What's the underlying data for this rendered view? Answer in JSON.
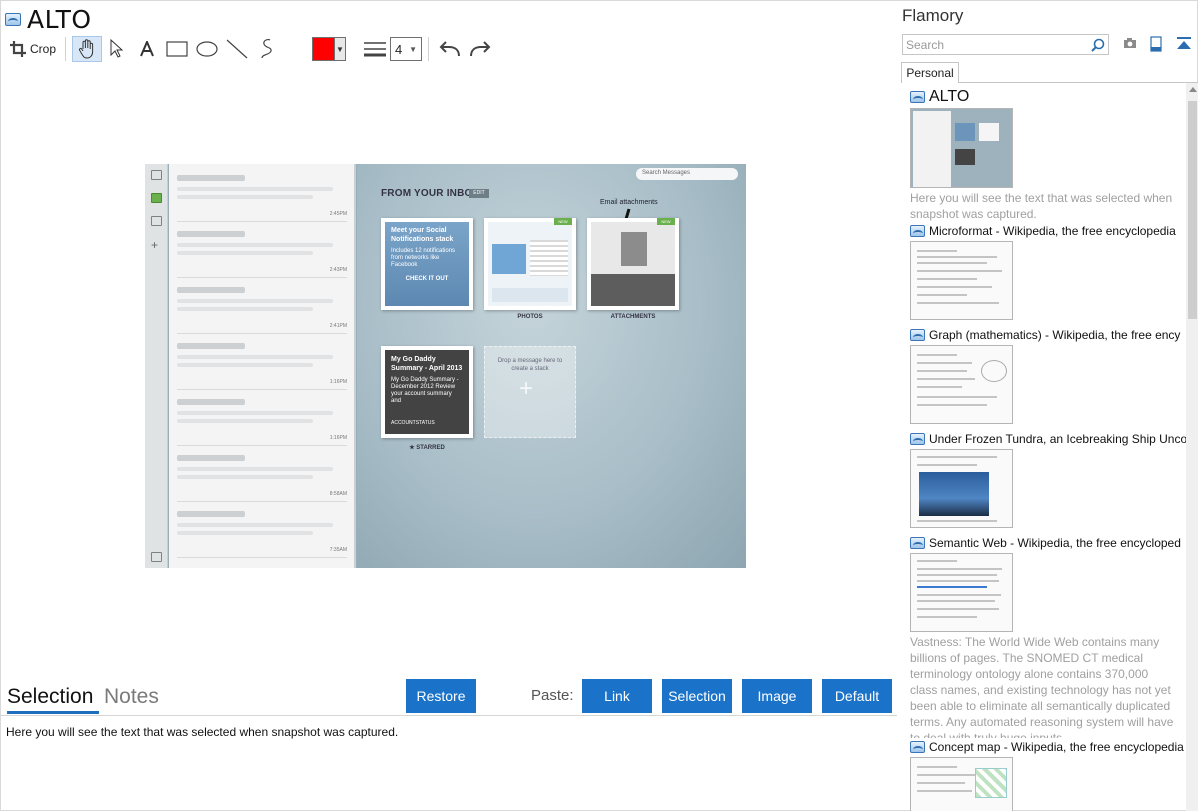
{
  "app": {
    "title": "ALTO",
    "brand": "Flamory"
  },
  "toolbar": {
    "crop_label": "Crop",
    "line_width": "4",
    "stroke_color": "#ff0000"
  },
  "screenshot": {
    "search_placeholder": "Search Messages",
    "inbox_heading": "FROM YOUR INBOX",
    "edit_tag": "EDIT",
    "email_attachments": "Email attachments",
    "new_tag": "NEW",
    "card_social": "Meet your Social Notifications stack",
    "card_social_sub": "Includes 12 notifications from networks like Facebook",
    "card_social_cta": "CHECK IT OUT",
    "caption_photos": "PHOTOS",
    "caption_attachments": "ATTACHMENTS",
    "card_godaddy": "My Go Daddy Summary - April 2013",
    "card_godaddy_sub": "My Go Daddy Summary - December 2012 Review your account summary and",
    "card_godaddy_foot": "ACCOUNTSTATUS",
    "caption_starred": "★ STARRED",
    "drop_text": "Drop a message here to create a stack",
    "mail_times": [
      "2:45PM",
      "2:43PM",
      "2:41PM",
      "1:16PM",
      "1:16PM",
      "8:58AM",
      "7:35AM"
    ]
  },
  "tabs": {
    "selection": "Selection",
    "notes": "Notes"
  },
  "buttons": {
    "restore": "Restore",
    "paste_label": "Paste:",
    "link": "Link",
    "selection": "Selection",
    "image": "Image",
    "default": "Default"
  },
  "selection_text": "Here you will see the text that was selected when snapshot was captured.",
  "sidebar": {
    "search_placeholder": "Search",
    "tab_personal": "Personal",
    "snapshots": [
      {
        "title": "ALTO",
        "desc": "Here you will see the text that was selected when snapshot was captured."
      },
      {
        "title": "Microformat - Wikipedia, the free encyclopedia",
        "desc": ""
      },
      {
        "title": "Graph (mathematics) - Wikipedia, the free ency",
        "desc": ""
      },
      {
        "title": "Under Frozen Tundra, an Icebreaking Ship Unco",
        "desc": ""
      },
      {
        "title": "Semantic Web - Wikipedia, the free encycloped",
        "desc": "Vastness: The World Wide Web contains many billions of pages. The SNOMED CT medical terminology ontology alone contains 370,000 class names, and existing technology has not yet been able to eliminate all semantically duplicated terms. Any automated reasoning system will have to deal with truly huge inputs."
      },
      {
        "title": "Concept map - Wikipedia, the free encyclopedia",
        "desc": ""
      }
    ]
  }
}
